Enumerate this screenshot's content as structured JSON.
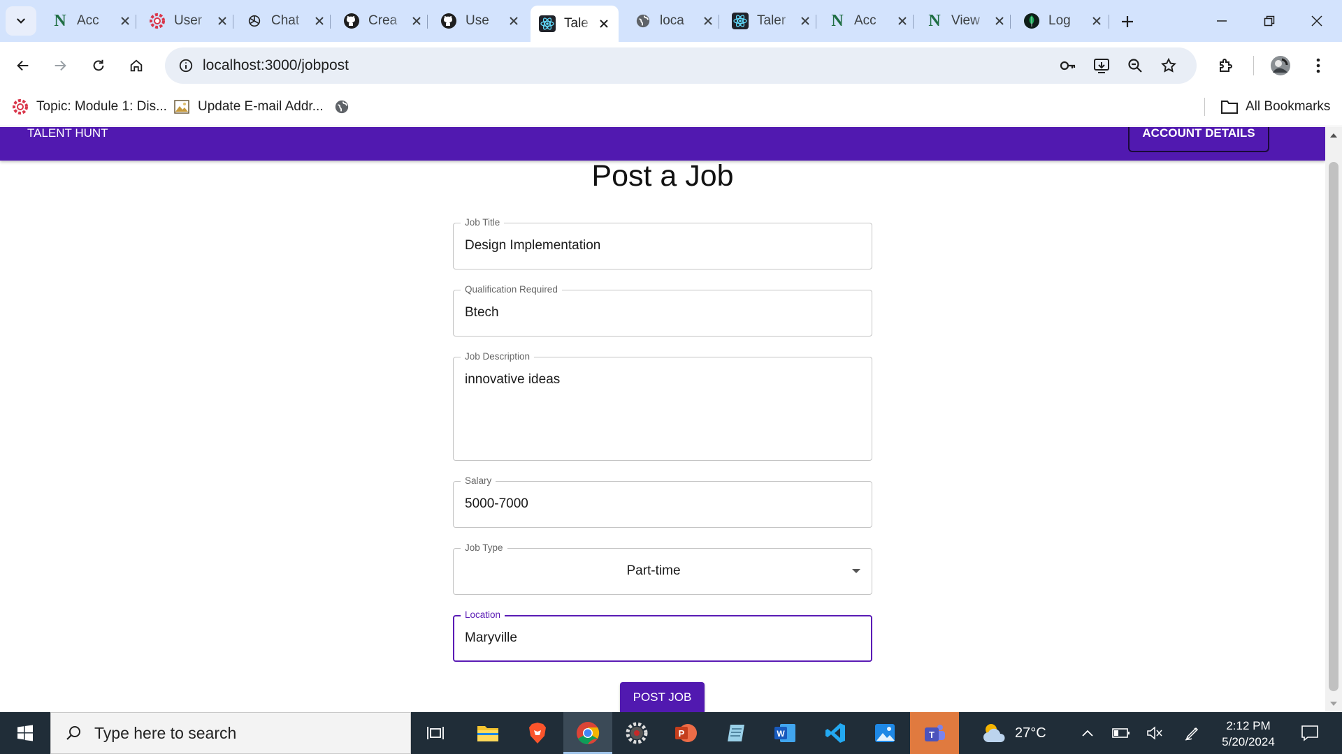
{
  "browser": {
    "tabs": [
      {
        "title": "Acc",
        "favicon": "notion-n-icon",
        "active": false
      },
      {
        "title": "User",
        "favicon": "gear-red-icon",
        "active": false
      },
      {
        "title": "Chat",
        "favicon": "openai-icon",
        "active": false
      },
      {
        "title": "Crea",
        "favicon": "github-icon",
        "active": false
      },
      {
        "title": "Use",
        "favicon": "github-icon",
        "active": false
      },
      {
        "title": "Tale",
        "favicon": "react-icon",
        "active": true
      },
      {
        "title": "loca",
        "favicon": "globe-icon",
        "active": false
      },
      {
        "title": "Taler",
        "favicon": "react-icon",
        "active": false
      },
      {
        "title": "Acc",
        "favicon": "notion-n-icon",
        "active": false
      },
      {
        "title": "View",
        "favicon": "notion-n-icon",
        "active": false
      },
      {
        "title": "Log",
        "favicon": "mongodb-leaf-icon",
        "active": false
      }
    ],
    "url": "localhost:3000/jobpost",
    "bookmarks": [
      {
        "label": "Topic: Module 1: Dis...",
        "icon": "gear-red-icon"
      },
      {
        "label": "Update E-mail Addr...",
        "icon": "image-icon"
      },
      {
        "label": "",
        "icon": "globe-icon"
      }
    ],
    "all_bookmarks_label": "All Bookmarks"
  },
  "app": {
    "brand": "TALENT HUNT",
    "account_button": "ACCOUNT DETAILS",
    "page_title": "Post a Job",
    "fields": {
      "job_title": {
        "label": "Job Title",
        "value": "Design Implementation"
      },
      "qualification": {
        "label": "Qualification Required",
        "value": "Btech"
      },
      "description": {
        "label": "Job Description",
        "value": "innovative ideas"
      },
      "salary": {
        "label": "Salary",
        "value": "5000-7000"
      },
      "job_type": {
        "label": "Job Type",
        "value": "Part-time"
      },
      "location": {
        "label": "Location",
        "value": "Maryville"
      }
    },
    "submit_button": "POST JOB",
    "accent_color": "#5119b0"
  },
  "taskbar": {
    "search_placeholder": "Type here to search",
    "weather": "27°C",
    "time": "2:12 PM",
    "date": "5/20/2024"
  }
}
